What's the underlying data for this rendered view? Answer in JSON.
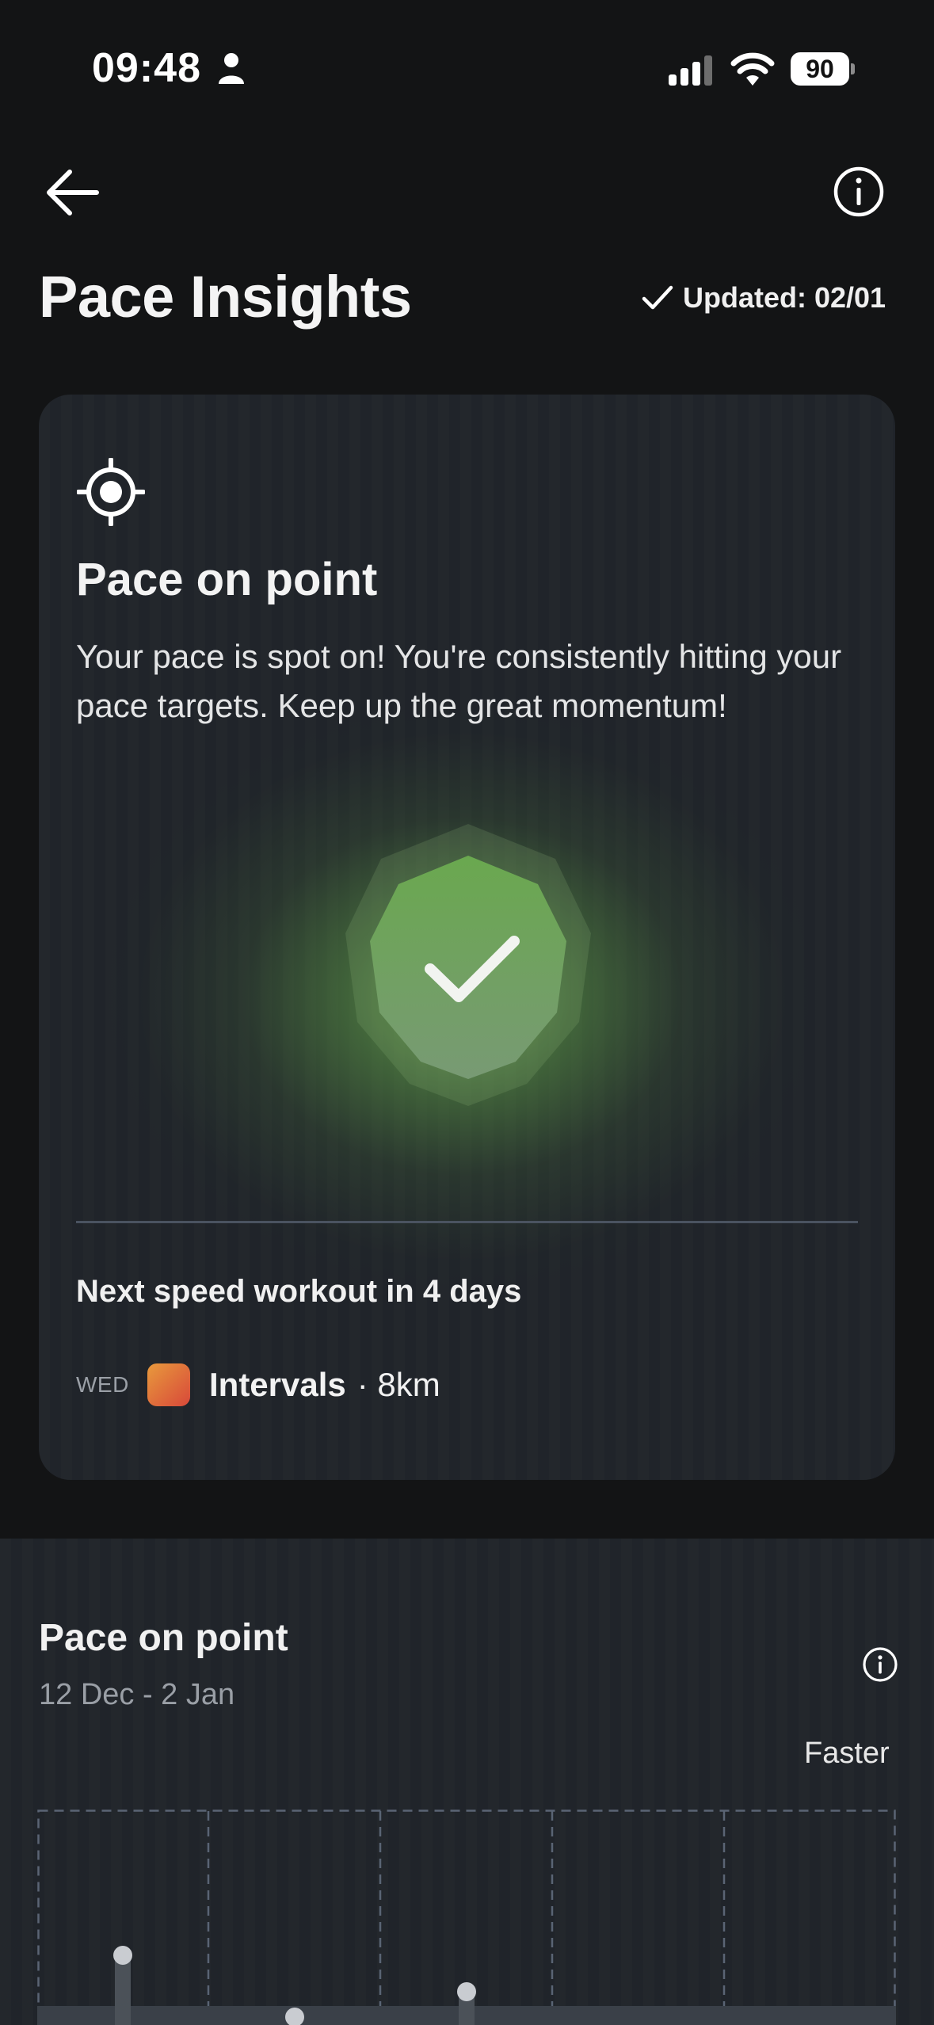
{
  "status_bar": {
    "time": "09:48",
    "battery": "90"
  },
  "header": {
    "title": "Pace Insights",
    "updated": "Updated: 02/01"
  },
  "card": {
    "title": "Pace on point",
    "description": "Your pace is spot on! You're consistently hitting your pace targets. Keep up the great momentum!",
    "next_workout": "Next speed workout in 4 days",
    "workout": {
      "day": "WED",
      "name": "Intervals",
      "distance": "· 8km"
    }
  },
  "section": {
    "title": "Pace on point",
    "dates": "12 Dec - 2 Jan",
    "faster_label": "Faster"
  },
  "colors": {
    "accent_green": "#6aa84f",
    "background": "#131415",
    "card": "#22262b"
  }
}
